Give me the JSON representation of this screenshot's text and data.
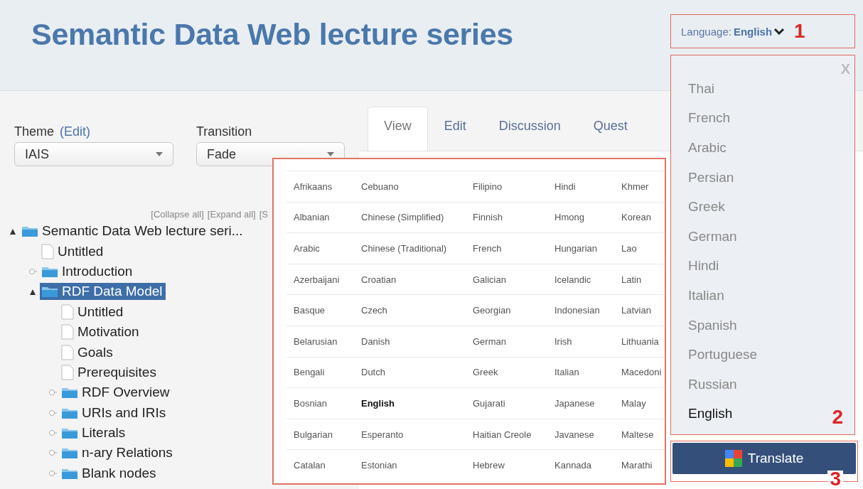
{
  "header": {
    "title": "Semantic Data Web lecture series"
  },
  "language_selector": {
    "label": "Language:",
    "value": "English",
    "callout": "1"
  },
  "language_menu": {
    "close": "X",
    "callout": "2",
    "items": [
      {
        "label": "Thai",
        "selected": false
      },
      {
        "label": "French",
        "selected": false
      },
      {
        "label": "Arabic",
        "selected": false
      },
      {
        "label": "Persian",
        "selected": false
      },
      {
        "label": "Greek",
        "selected": false
      },
      {
        "label": "German",
        "selected": false
      },
      {
        "label": "Hindi",
        "selected": false
      },
      {
        "label": "Italian",
        "selected": false
      },
      {
        "label": "Spanish",
        "selected": false
      },
      {
        "label": "Portuguese",
        "selected": false
      },
      {
        "label": "Russian",
        "selected": false
      },
      {
        "label": "English",
        "selected": true
      }
    ]
  },
  "translate_button": {
    "label": "Translate",
    "callout": "3"
  },
  "theme": {
    "label": "Theme",
    "edit_link": "(Edit)",
    "value": "IAIS"
  },
  "transition": {
    "label": "Transition",
    "value": "Fade"
  },
  "tree_links": [
    "[Collapse all]",
    "[Expand all]",
    "[S"
  ],
  "tree": [
    {
      "label": "Semantic Data Web lecture seri...",
      "kind": "folder",
      "expanded": true,
      "selected": false,
      "children": [
        {
          "label": "Untitled",
          "kind": "page",
          "selected": false
        },
        {
          "label": "Introduction",
          "kind": "folder",
          "expanded": false,
          "selected": false
        },
        {
          "label": "RDF Data Model",
          "kind": "folder",
          "expanded": true,
          "selected": true,
          "children": [
            {
              "label": "Untitled",
              "kind": "page",
              "selected": false
            },
            {
              "label": "Motivation",
              "kind": "page",
              "selected": false
            },
            {
              "label": "Goals",
              "kind": "page",
              "selected": false
            },
            {
              "label": "Prerequisites",
              "kind": "page",
              "selected": false
            },
            {
              "label": "RDF Overview",
              "kind": "folder",
              "expanded": false,
              "selected": false
            },
            {
              "label": "URIs and IRIs",
              "kind": "folder",
              "expanded": false,
              "selected": false
            },
            {
              "label": "Literals",
              "kind": "folder",
              "expanded": false,
              "selected": false
            },
            {
              "label": "n-ary Relations",
              "kind": "folder",
              "expanded": false,
              "selected": false
            },
            {
              "label": "Blank nodes",
              "kind": "folder",
              "expanded": false,
              "selected": false
            }
          ]
        }
      ]
    }
  ],
  "tabs": [
    {
      "label": "View",
      "selected": true
    },
    {
      "label": "Edit",
      "selected": false
    },
    {
      "label": "Discussion",
      "selected": false
    },
    {
      "label": "Quest",
      "selected": false
    }
  ],
  "language_grid": {
    "rows": [
      [
        {
          "label": "Afrikaans",
          "selected": false
        },
        {
          "label": "Cebuano",
          "selected": false
        },
        {
          "label": "Filipino",
          "selected": false
        },
        {
          "label": "Hindi",
          "selected": false
        },
        {
          "label": "Khmer",
          "selected": false
        }
      ],
      [
        {
          "label": "Albanian",
          "selected": false
        },
        {
          "label": "Chinese (Simplified)",
          "selected": false
        },
        {
          "label": "Finnish",
          "selected": false
        },
        {
          "label": "Hmong",
          "selected": false
        },
        {
          "label": "Korean",
          "selected": false
        }
      ],
      [
        {
          "label": "Arabic",
          "selected": false
        },
        {
          "label": "Chinese (Traditional)",
          "selected": false
        },
        {
          "label": "French",
          "selected": false
        },
        {
          "label": "Hungarian",
          "selected": false
        },
        {
          "label": "Lao",
          "selected": false
        }
      ],
      [
        {
          "label": "Azerbaijani",
          "selected": false
        },
        {
          "label": "Croatian",
          "selected": false
        },
        {
          "label": "Galician",
          "selected": false
        },
        {
          "label": "Icelandic",
          "selected": false
        },
        {
          "label": "Latin",
          "selected": false
        }
      ],
      [
        {
          "label": "Basque",
          "selected": false
        },
        {
          "label": "Czech",
          "selected": false
        },
        {
          "label": "Georgian",
          "selected": false
        },
        {
          "label": "Indonesian",
          "selected": false
        },
        {
          "label": "Latvian",
          "selected": false
        }
      ],
      [
        {
          "label": "Belarusian",
          "selected": false
        },
        {
          "label": "Danish",
          "selected": false
        },
        {
          "label": "German",
          "selected": false
        },
        {
          "label": "Irish",
          "selected": false
        },
        {
          "label": "Lithuania",
          "selected": false
        }
      ],
      [
        {
          "label": "Bengali",
          "selected": false
        },
        {
          "label": "Dutch",
          "selected": false
        },
        {
          "label": "Greek",
          "selected": false
        },
        {
          "label": "Italian",
          "selected": false
        },
        {
          "label": "Macedoni",
          "selected": false
        }
      ],
      [
        {
          "label": "Bosnian",
          "selected": false
        },
        {
          "label": "English",
          "selected": true
        },
        {
          "label": "Gujarati",
          "selected": false
        },
        {
          "label": "Japanese",
          "selected": false
        },
        {
          "label": "Malay",
          "selected": false
        }
      ],
      [
        {
          "label": "Bulgarian",
          "selected": false
        },
        {
          "label": "Esperanto",
          "selected": false
        },
        {
          "label": "Haitian Creole",
          "selected": false
        },
        {
          "label": "Javanese",
          "selected": false
        },
        {
          "label": "Maltese",
          "selected": false
        }
      ],
      [
        {
          "label": "Catalan",
          "selected": false
        },
        {
          "label": "Estonian",
          "selected": false
        },
        {
          "label": "Hebrew",
          "selected": false
        },
        {
          "label": "Kannada",
          "selected": false
        },
        {
          "label": "Marathi",
          "selected": false
        }
      ]
    ]
  }
}
